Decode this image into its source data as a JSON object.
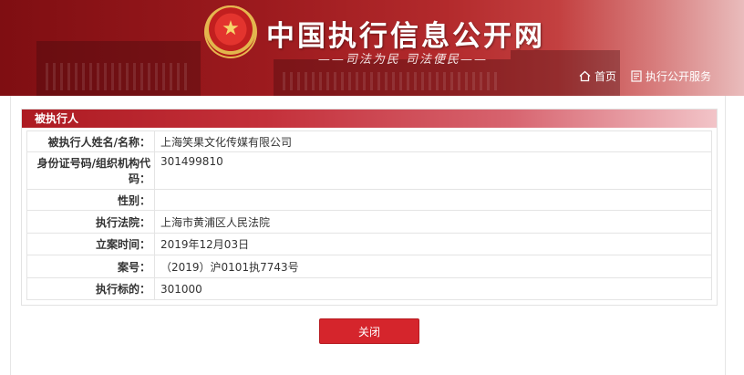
{
  "header": {
    "site_title": "中国执行信息公开网",
    "slogan": "——司法为民 司法便民——",
    "nav": [
      {
        "label": "首页",
        "icon": "home-icon"
      },
      {
        "label": "执行公开服务",
        "icon": "document-icon"
      }
    ]
  },
  "section": {
    "title": "被执行人",
    "rows": [
      {
        "label": "被执行人姓名/名称：",
        "value": "上海笑果文化传媒有限公司"
      },
      {
        "label": "身份证号码/组织机构代码：",
        "value": "301499810"
      },
      {
        "label": "性别：",
        "value": ""
      },
      {
        "label": "执行法院：",
        "value": "上海市黄浦区人民法院"
      },
      {
        "label": "立案时间：",
        "value": "2019年12月03日"
      },
      {
        "label": "案号：",
        "value": "（2019）沪0101执7743号"
      },
      {
        "label": "执行标的：",
        "value": "301000"
      }
    ]
  },
  "close_label": "关闭",
  "colors": {
    "brand_red": "#c4303a",
    "button_red": "#d5252c"
  }
}
